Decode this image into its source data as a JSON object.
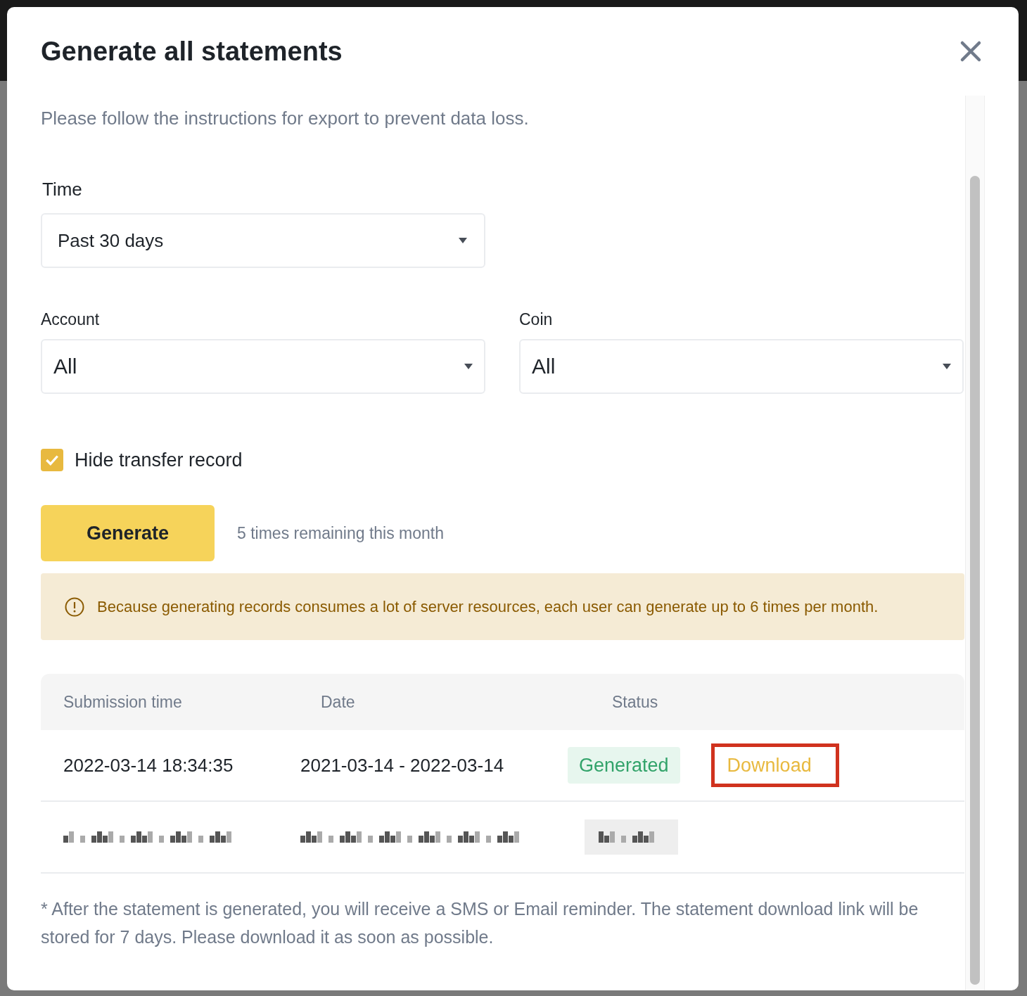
{
  "dialog": {
    "title": "Generate all statements",
    "intro": "Please follow the instructions for export to prevent data loss."
  },
  "time_field": {
    "label": "Time",
    "value": "Past 30 days"
  },
  "filters": [
    {
      "label": "Account",
      "value": "All"
    },
    {
      "label": "Coin",
      "value": "All"
    }
  ],
  "hide_transfer": {
    "label": "Hide transfer record",
    "checked": true
  },
  "generate": {
    "button": "Generate",
    "remaining": "5 times remaining this month"
  },
  "notice": "Because generating records consumes a lot of server resources, each user can generate up to 6 times per month.",
  "table": {
    "columns": [
      "Submission time",
      "Date",
      "Status"
    ],
    "rows": [
      {
        "kind": "record",
        "submitted": "2022-03-14 18:34:35",
        "date": "2021-03-14 - 2022-03-14",
        "status": "Generated",
        "action": "Download",
        "highlighted": true
      },
      {
        "kind": "redacted"
      }
    ]
  },
  "footnote": "* After the statement is generated, you will receive a SMS or Email reminder. The statement download link will be stored for 7 days. Please download it as soon as possible."
}
